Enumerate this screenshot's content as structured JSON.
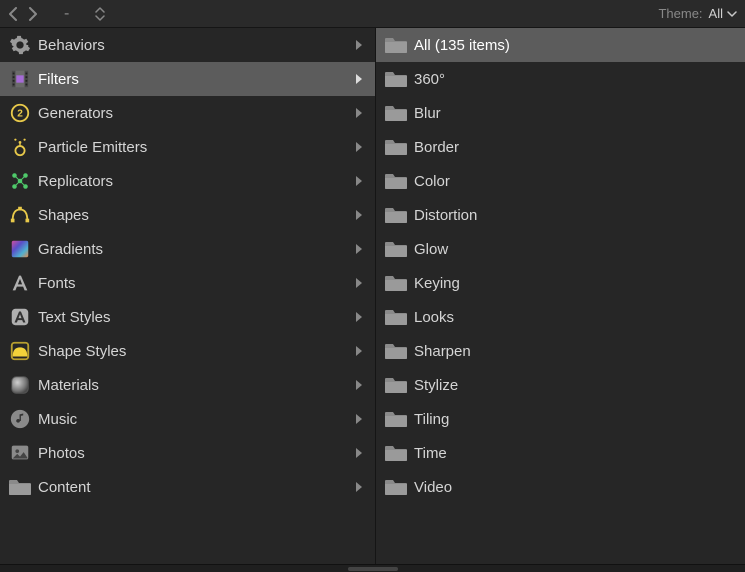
{
  "toolbar": {
    "theme_label": "Theme:",
    "theme_value": "All"
  },
  "left": {
    "selected_index": 1,
    "items": [
      {
        "label": "Behaviors",
        "name": "behaviors",
        "icon": "gear"
      },
      {
        "label": "Filters",
        "name": "filters",
        "icon": "film"
      },
      {
        "label": "Generators",
        "name": "generators",
        "icon": "generator"
      },
      {
        "label": "Particle Emitters",
        "name": "particle-emitters",
        "icon": "particle"
      },
      {
        "label": "Replicators",
        "name": "replicators",
        "icon": "replicator"
      },
      {
        "label": "Shapes",
        "name": "shapes",
        "icon": "shape"
      },
      {
        "label": "Gradients",
        "name": "gradients",
        "icon": "gradient"
      },
      {
        "label": "Fonts",
        "name": "fonts",
        "icon": "font"
      },
      {
        "label": "Text Styles",
        "name": "text-styles",
        "icon": "textstyle"
      },
      {
        "label": "Shape Styles",
        "name": "shape-styles",
        "icon": "shapestyle"
      },
      {
        "label": "Materials",
        "name": "materials",
        "icon": "material"
      },
      {
        "label": "Music",
        "name": "music",
        "icon": "music"
      },
      {
        "label": "Photos",
        "name": "photos",
        "icon": "photo"
      },
      {
        "label": "Content",
        "name": "content",
        "icon": "folder"
      }
    ]
  },
  "right": {
    "selected_index": 0,
    "items": [
      {
        "label": "All (135 items)",
        "name": "all"
      },
      {
        "label": "360°",
        "name": "360"
      },
      {
        "label": "Blur",
        "name": "blur"
      },
      {
        "label": "Border",
        "name": "border"
      },
      {
        "label": "Color",
        "name": "color"
      },
      {
        "label": "Distortion",
        "name": "distortion"
      },
      {
        "label": "Glow",
        "name": "glow"
      },
      {
        "label": "Keying",
        "name": "keying"
      },
      {
        "label": "Looks",
        "name": "looks"
      },
      {
        "label": "Sharpen",
        "name": "sharpen"
      },
      {
        "label": "Stylize",
        "name": "stylize"
      },
      {
        "label": "Tiling",
        "name": "tiling"
      },
      {
        "label": "Time",
        "name": "time"
      },
      {
        "label": "Video",
        "name": "video"
      }
    ]
  }
}
